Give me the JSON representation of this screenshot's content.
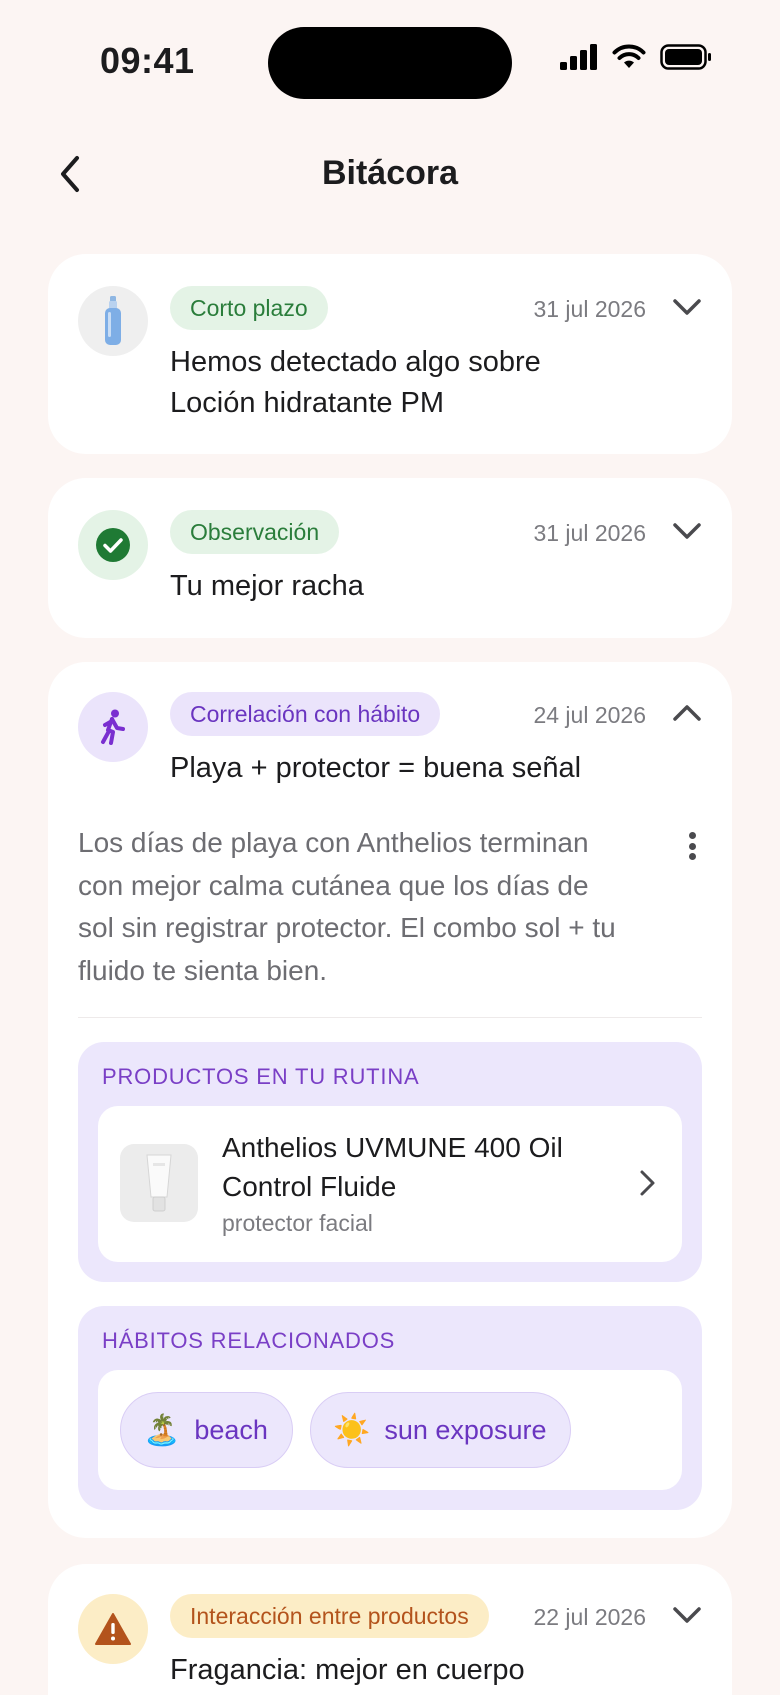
{
  "status_bar": {
    "time": "09:41"
  },
  "header": {
    "title": "Bitácora"
  },
  "cards": [
    {
      "tag": "Corto plazo",
      "date": "31 jul 2026",
      "title_line1": "Hemos detectado algo sobre",
      "title_line2": "Loción hidratante PM",
      "icon": "lotion-bottle-icon",
      "expanded": false
    },
    {
      "tag": "Observación",
      "date": "31 jul 2026",
      "title_line1": "Tu mejor racha",
      "icon": "check-circle-icon",
      "expanded": false
    },
    {
      "tag": "Correlación con hábito",
      "date": "24 jul 2026",
      "title_line1": "Playa + protector = buena señal",
      "icon": "walking-person-icon",
      "expanded": true,
      "body_lines": [
        "Los días de playa con Anthelios terminan",
        "con mejor calma cutánea que los días de",
        "sol sin registrar protector. El combo sol + tu",
        "fluido te sienta bien."
      ],
      "products_label": "PRODUCTOS EN TU RUTINA",
      "product": {
        "name_line1": "Anthelios UVMUNE 400 Oil",
        "name_line2": "Control Fluide",
        "category": "protector facial"
      },
      "habits_label": "HÁBITOS RELACIONADOS",
      "habits": [
        {
          "emoji": "🏝️",
          "label": "beach"
        },
        {
          "emoji": "☀️",
          "label": "sun exposure"
        }
      ]
    },
    {
      "tag": "Interacción entre productos",
      "date": "22 jul 2026",
      "title_line1": "Fragancia: mejor en cuerpo",
      "icon": "warning-icon",
      "expanded": false
    }
  ],
  "colors": {
    "background": "#fcf5f3",
    "green_tag": "#2a7d3b",
    "purple_tag": "#6a35c0",
    "orange_tag": "#b3531c"
  }
}
